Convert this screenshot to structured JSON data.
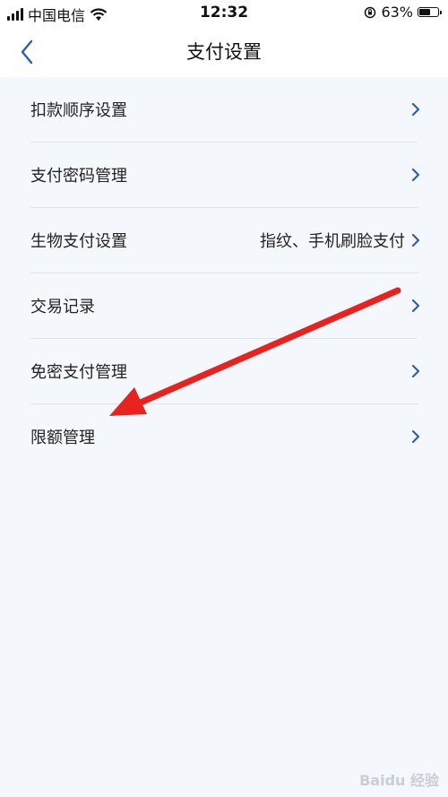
{
  "status_bar": {
    "carrier": "中国电信",
    "time": "12:32",
    "battery_percent": "63%",
    "battery_level": 0.63
  },
  "nav": {
    "title": "支付设置",
    "back_icon": "chevron-left-icon"
  },
  "settings": [
    {
      "label": "扣款顺序设置",
      "value": ""
    },
    {
      "label": "支付密码管理",
      "value": ""
    },
    {
      "label": "生物支付设置",
      "value": "指纹、手机刷脸支付"
    },
    {
      "label": "交易记录",
      "value": ""
    },
    {
      "label": "免密支付管理",
      "value": ""
    },
    {
      "label": "限额管理",
      "value": ""
    }
  ],
  "watermark": "Baidu 经验",
  "colors": {
    "accent": "#2f5fa8",
    "background": "#f4f7fc",
    "annotation_arrow": "#e8231f"
  }
}
